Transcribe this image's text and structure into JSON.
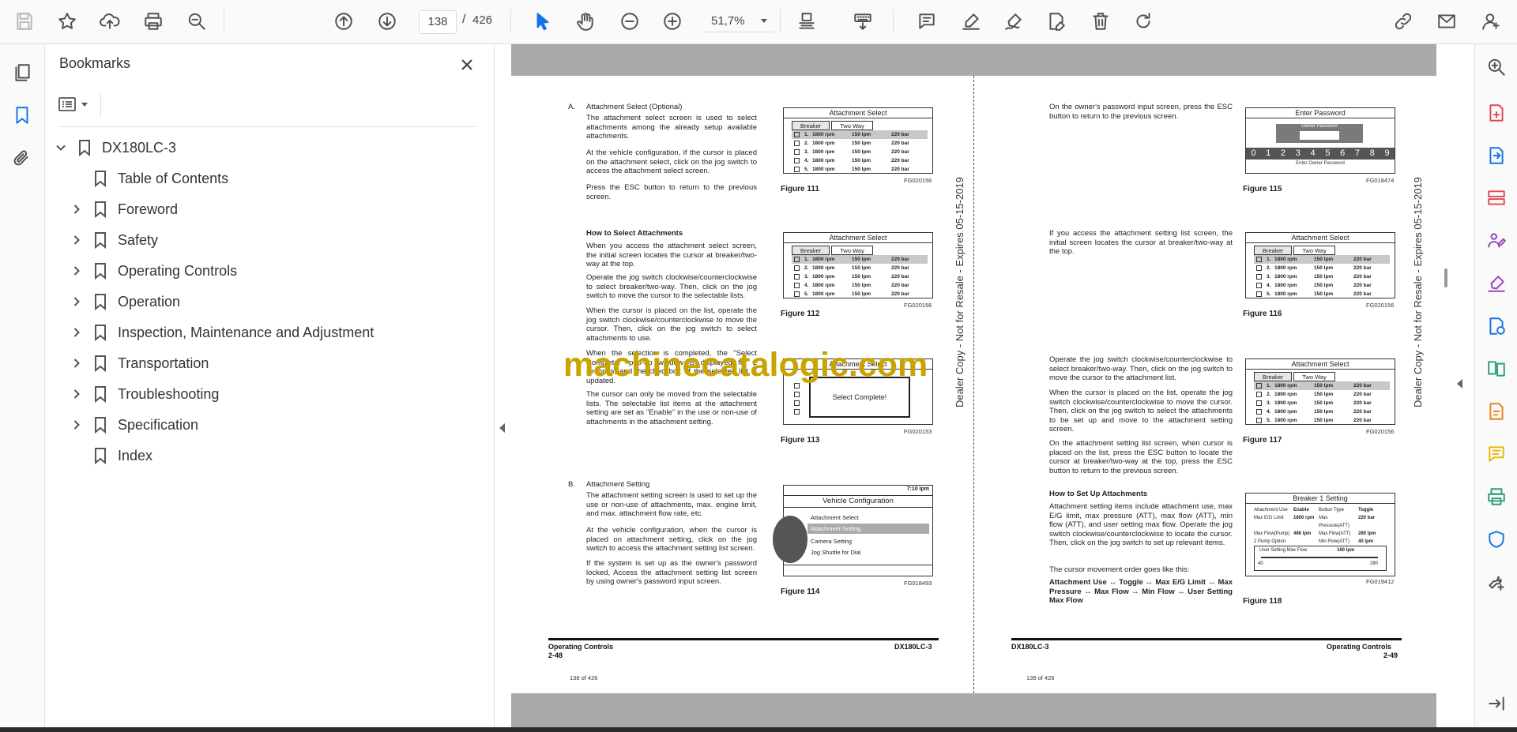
{
  "toolbar": {
    "current_page": "138",
    "page_separator": "/",
    "total_pages": "426",
    "zoom": "51,7%",
    "buttons": [
      "save-icon",
      "star-icon",
      "upload-icon",
      "print-icon",
      "zoom-search-icon",
      "page-up-icon",
      "page-down-icon",
      "select-cursor-icon",
      "hand-icon",
      "zoom-out-icon",
      "zoom-in-icon",
      "fit-page-icon",
      "keyboard-scroll-icon",
      "comment-icon",
      "highlight-icon",
      "sign-icon",
      "edit-text-icon",
      "delete-icon",
      "rotate-icon",
      "share-link-icon",
      "email-icon",
      "account-icon"
    ]
  },
  "bookmarks_panel": {
    "title": "Bookmarks",
    "root": "DX180LC-3",
    "items": [
      {
        "label": "Table of Contents",
        "expandable": false
      },
      {
        "label": "Foreword",
        "expandable": true
      },
      {
        "label": "Safety",
        "expandable": true
      },
      {
        "label": "Operating Controls",
        "expandable": true
      },
      {
        "label": "Operation",
        "expandable": true
      },
      {
        "label": "Inspection, Maintenance and Adjustment",
        "expandable": true
      },
      {
        "label": "Transportation",
        "expandable": true
      },
      {
        "label": "Troubleshooting",
        "expandable": true
      },
      {
        "label": "Specification",
        "expandable": true
      },
      {
        "label": "Index",
        "expandable": false
      }
    ]
  },
  "watermark": "machinecatalogic.com",
  "left_page": {
    "dealer_note": "Dealer Copy - Not for Resale - Expires 05-15-2019",
    "sectionA_label": "A.",
    "sectionA_title": "Attachment Select (Optional)",
    "p1": "The attachment select screen is used to select attachments among the already setup available attachments.",
    "p2": "At the vehicle configuration, if the cursor is placed on the attachment select, click on the jog switch to access the attachment select screen.",
    "p3": "Press the ESC button to return to the previous screen.",
    "howto_title": "How to Select Attachments",
    "p4": "When you access the attachment select screen, the initial screen locates the cursor at breaker/two-way at the top.",
    "p5": "Operate the jog switch clockwise/counterclockwise to select breaker/two-way. Then, click on the jog switch to move the cursor to the selectable lists.",
    "p6": "When the cursor is placed on the list, operate the jog switch clockwise/counterclockwise to move the cursor. Then, click on the jog switch to select attachments to use.",
    "p7": "When the selection is completed, the \"Select Complete!\" pop-up window is displayed for 2 seconds, and the checkbox of the selected list is updated.",
    "p8": "The cursor can only be moved from the selectable lists. The selectable list items at the attachment setting are set as \"Enable\" in the use or non-use of attachments in the attachment setting.",
    "sectionB_label": "B.",
    "sectionB_title": "Attachment Setting",
    "p9": "The attachment setting screen is used to set up the use or non-use of attachments, max. engine limit, and max. attachment flow rate, etc.",
    "p10": "At the vehicle configuration, when the cursor is placed on attachment setting, click on the jog switch to access the attachment setting list screen.",
    "p11": "If the system is set up as the owner's password locked, Access the attachment setting list screen by using owner's password input screen.",
    "fig111": {
      "title": "Attachment Select",
      "caption": "Figure 111",
      "code": "FG020156"
    },
    "fig112": {
      "title": "Attachment Select",
      "caption": "Figure 112",
      "code": "FG020156"
    },
    "fig113": {
      "title": "Attachment Select",
      "caption": "Figure 113",
      "code": "FG020153",
      "popup": "Select Complete!"
    },
    "fig114": {
      "title": "Vehicle Configuration",
      "caption": "Figure 114",
      "code": "FG018493",
      "status": "7:10 Ipm",
      "menu": [
        "Attachment Select",
        "Attachment Setting",
        "Camera Setting",
        "Jog Shuttle for Dial"
      ]
    },
    "footer_left": "Operating Controls",
    "footer_right": "DX180LC-3",
    "page_no": "2-48",
    "page_count": "138 of 426"
  },
  "right_page": {
    "dealer_note": "Dealer Copy - Not for Resale - Expires 05-15-2019",
    "p1": "On the owner's password input screen, press the ESC button to return to the previous screen.",
    "p2": "If you access the attachment setting list screen, the initial screen locates the cursor at breaker/two-way at the top.",
    "p3": "Operate the jog switch clockwise/counterclockwise to select breaker/two-way. Then, click on the jog switch to move the cursor to the attachment list.",
    "p4": "When the cursor is placed on the list, operate the jog switch clockwise/counterclockwise to move the cursor. Then, click on the jog switch to select the attachments to be set up and move to the attachment setting screen.",
    "p5": "On the attachment setting list screen, when cursor is placed on the list, press the ESC button to locate the cursor at breaker/two-way at the top, press the ESC button to return to the previous screen.",
    "howto_title": "How to Set Up Attachments",
    "p6": "Attachment setting items include attachment use, max E/G limit, max pressure (ATT), max flow (ATT), min flow (ATT), and user setting max flow. Operate the jog switch clockwise/counterclockwise to locate the cursor. Then, click on the jog switch to set up relevant items.",
    "p7": "The cursor movement order goes like this:",
    "p8": "Attachment Use ↔ Toggle ↔ Max E/G Limit ↔ Max Pressure ↔ Max Flow ↔ Min Flow ↔ User Setting Max Flow",
    "fig115": {
      "title": "Enter Password",
      "caption": "Figure 115",
      "code": "FG018474",
      "label": "Owner Password",
      "digits": [
        "0",
        "1",
        "2",
        "3",
        "4",
        "5",
        "6",
        "7",
        "8",
        "9"
      ],
      "hint": "Enter Owner Password"
    },
    "fig116": {
      "title": "Attachment Select",
      "caption": "Figure 116",
      "code": "FG020156"
    },
    "fig117": {
      "title": "Attachment Select",
      "caption": "Figure 117",
      "code": "FG020156"
    },
    "fig118": {
      "title": "Breaker 1 Setting",
      "caption": "Figure 118",
      "code": "FG019412",
      "rows": [
        [
          "Attachment Use",
          "Enable",
          "Button Type",
          "Toggle"
        ],
        [
          "Max E/G Limit",
          "1800 rpm",
          "Max Pressure(ATT)",
          "220 bar"
        ],
        [
          "Max Flow(Pump)",
          "486 lpm",
          "Max Flow(ATT)",
          "280 lpm"
        ],
        [
          "2 Pump Option",
          "",
          "Min Flow(ATT)",
          "40 lpm"
        ]
      ],
      "user_label": "User Setting Max Flow",
      "user_value": "160 lpm",
      "min": "40",
      "max": "280"
    },
    "footer_left": "DX180LC-3",
    "footer_right": "Operating Controls",
    "page_no": "2-49",
    "page_count": "139 of 426"
  },
  "attachment_list": {
    "tab1": "Breaker",
    "tab2": "Two Way",
    "rows": [
      {
        "num": "1.",
        "rpm": "1800 rpm",
        "flow": "150 lpm",
        "bar": "220 bar"
      },
      {
        "num": "2.",
        "rpm": "1800 rpm",
        "flow": "150 lpm",
        "bar": "220 bar"
      },
      {
        "num": "3.",
        "rpm": "1800 rpm",
        "flow": "150 lpm",
        "bar": "220 bar"
      },
      {
        "num": "4.",
        "rpm": "1800 rpm",
        "flow": "150 lpm",
        "bar": "220 bar"
      },
      {
        "num": "5.",
        "rpm": "1800 rpm",
        "flow": "150 lpm",
        "bar": "220 bar"
      }
    ]
  },
  "colors": {
    "accent": "#1473e6",
    "watermark": "#c9a400",
    "panel_bg": "#fafafa"
  }
}
